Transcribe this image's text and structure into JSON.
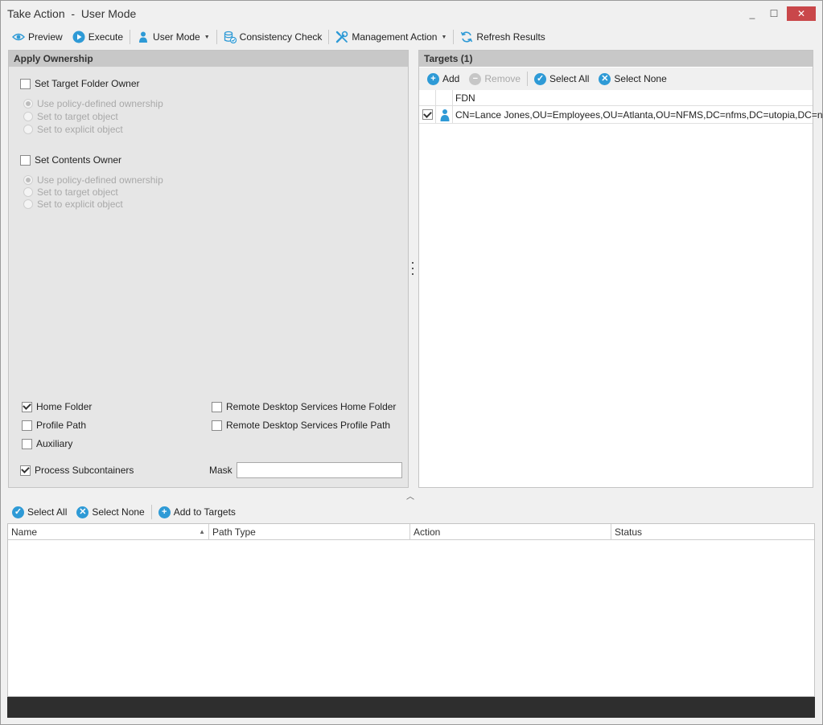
{
  "window": {
    "title": "Take Action  -  User Mode",
    "minimize": "_",
    "maximize": "☐",
    "close": "✕"
  },
  "toolbar": {
    "preview": "Preview",
    "execute": "Execute",
    "user_mode": "User Mode",
    "consistency_check": "Consistency Check",
    "management_action": "Management Action",
    "refresh_results": "Refresh Results"
  },
  "apply_ownership": {
    "header": "Apply Ownership",
    "target_folder_owner": {
      "label": "Set Target Folder Owner",
      "checked": false,
      "options": [
        "Use policy-defined ownership",
        "Set to target object",
        "Set to explicit object"
      ],
      "selected": 0
    },
    "contents_owner": {
      "label": "Set Contents Owner",
      "checked": false,
      "options": [
        "Use policy-defined ownership",
        "Set to target object",
        "Set to explicit object"
      ],
      "selected": 0
    },
    "home_folder": "Home Folder",
    "profile_path": "Profile Path",
    "auxiliary": "Auxiliary",
    "rds_home_folder": "Remote Desktop Services Home Folder",
    "rds_profile_path": "Remote Desktop Services Profile Path",
    "process_subcontainers": "Process Subcontainers",
    "mask_label": "Mask",
    "mask_value": ""
  },
  "targets": {
    "header": "Targets  (1)",
    "add": "Add",
    "remove": "Remove",
    "select_all": "Select All",
    "select_none": "Select None",
    "column_fdn": "FDN",
    "rows": [
      {
        "checked": true,
        "fdn": "CN=Lance Jones,OU=Employees,OU=Atlanta,OU=NFMS,DC=nfms,DC=utopia,DC=nov..."
      }
    ]
  },
  "results": {
    "select_all": "Select All",
    "select_none": "Select None",
    "add_to_targets": "Add to Targets",
    "columns": [
      "Name",
      "Path Type",
      "Action",
      "Status"
    ]
  },
  "colors": {
    "accent": "#2e9ad6",
    "close": "#c9474a",
    "status_bar": "#2e2e2e"
  }
}
